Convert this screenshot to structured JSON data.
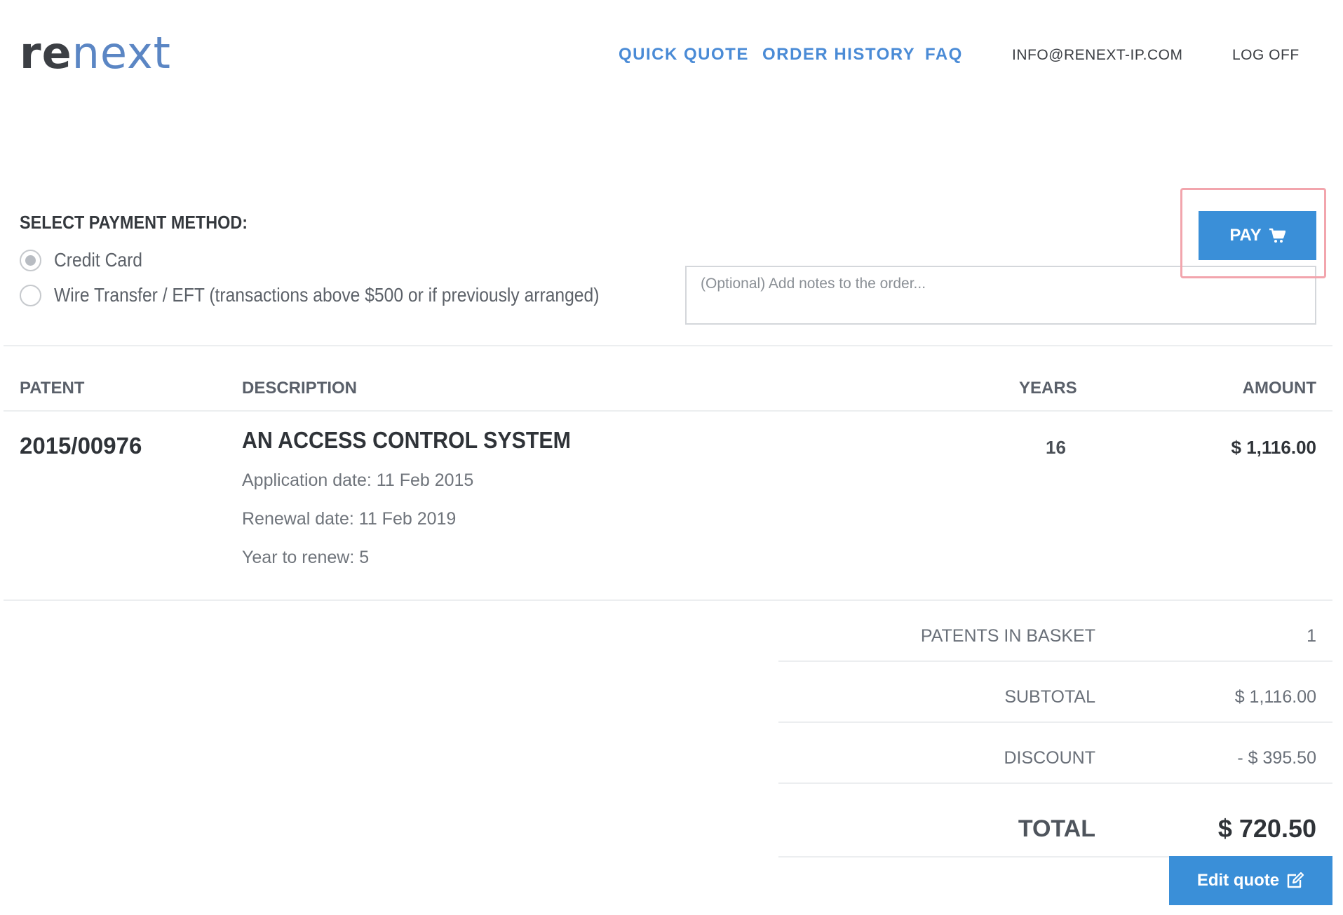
{
  "brand": {
    "logo_part1": "re",
    "logo_part2": "next"
  },
  "nav": {
    "quick_quote": "QUICK QUOTE",
    "order_history": "ORDER HISTORY",
    "faq": "FAQ",
    "email": "INFO@RENEXT-IP.COM",
    "log_off": "LOG OFF"
  },
  "payment": {
    "title": "SELECT PAYMENT METHOD:",
    "options": [
      {
        "label": "Credit Card",
        "selected": true
      },
      {
        "label": "Wire Transfer / EFT (transactions above $500 or if previously arranged)",
        "selected": false
      }
    ],
    "notes_placeholder": "(Optional) Add notes to the order...",
    "pay_label": "PAY",
    "pay_icon": "cart-icon"
  },
  "table": {
    "headers": {
      "patent": "PATENT",
      "description": "DESCRIPTION",
      "years": "YEARS",
      "amount": "AMOUNT"
    },
    "rows": [
      {
        "patent": "2015/00976",
        "title": "AN ACCESS CONTROL SYSTEM",
        "application_date": "Application date: 11 Feb 2015",
        "renewal_date": "Renewal date: 11 Feb 2019",
        "year_to_renew": "Year to renew: 5",
        "years": "16",
        "amount": "$ 1,116.00"
      }
    ]
  },
  "summary": {
    "patents_in_basket_label": "PATENTS IN BASKET",
    "patents_in_basket_value": "1",
    "subtotal_label": "SUBTOTAL",
    "subtotal_value": "$ 1,116.00",
    "discount_label": "DISCOUNT",
    "discount_value": "- $ 395.50",
    "total_label": "TOTAL",
    "total_value": "$ 720.50"
  },
  "edit_quote_label": "Edit quote",
  "colors": {
    "accent": "#3a8fd8",
    "nav_link": "#4a8bd6",
    "highlight": "#f2a5ad"
  }
}
